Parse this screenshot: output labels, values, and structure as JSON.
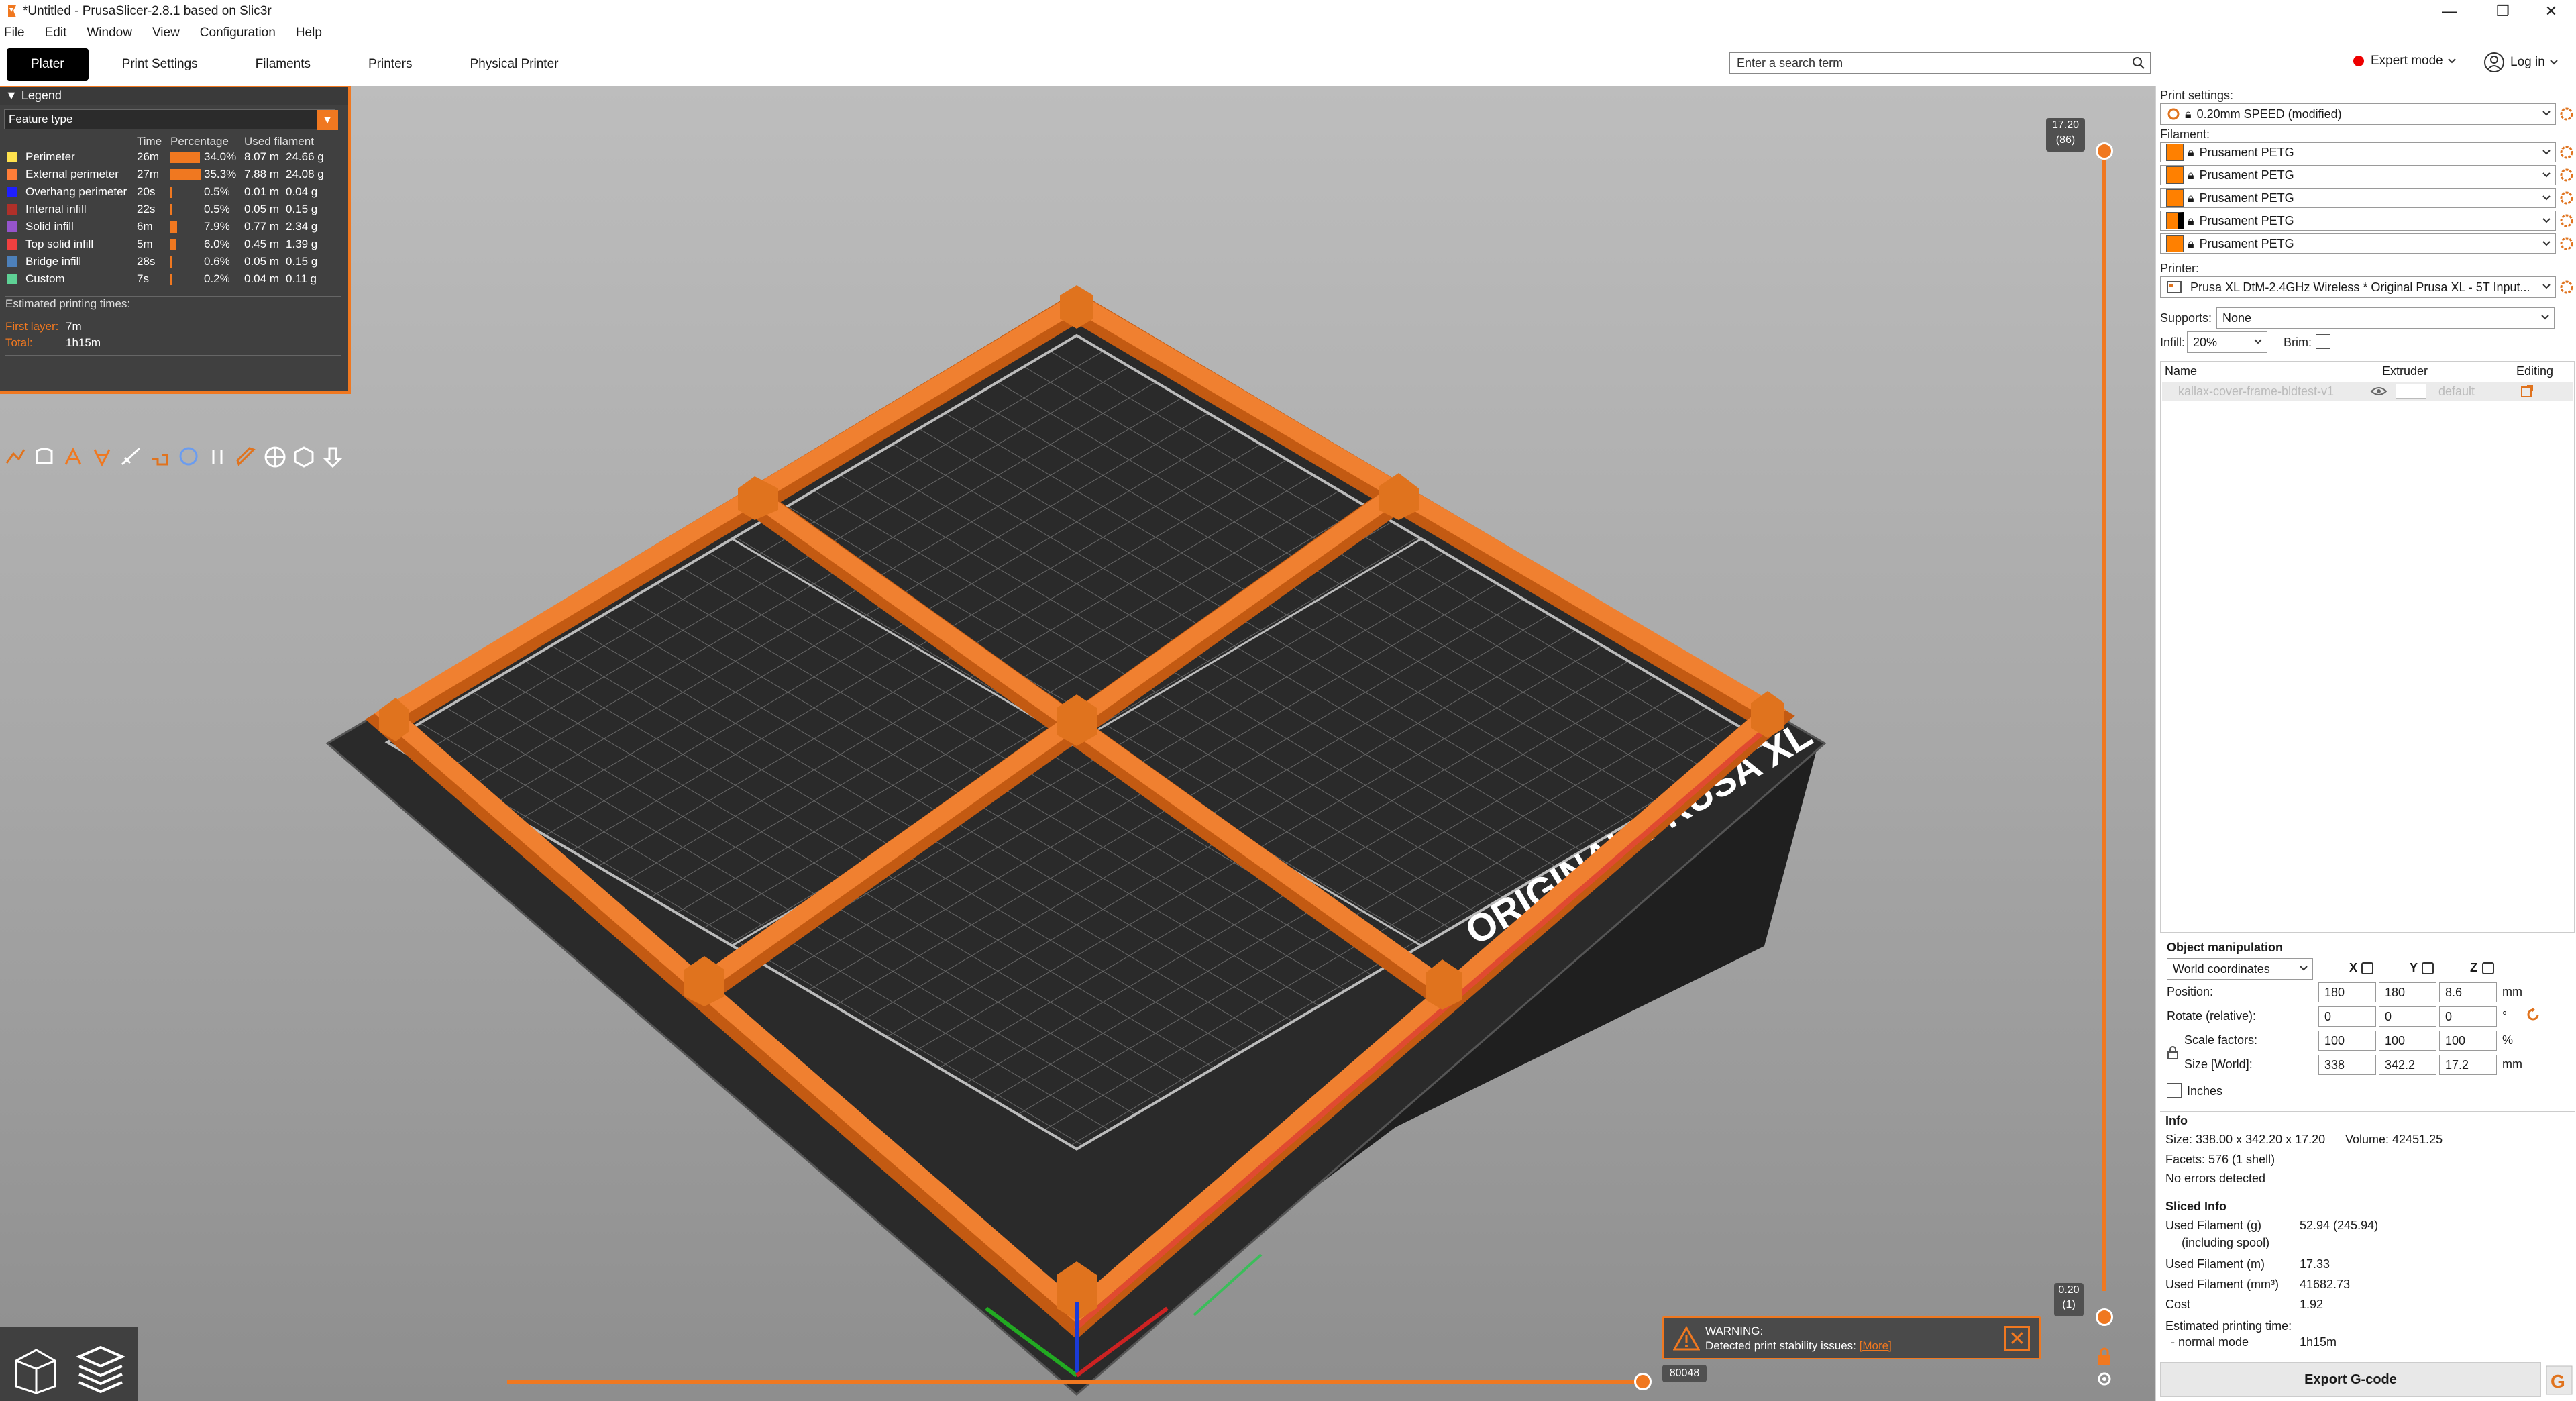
{
  "window": {
    "title": "*Untitled - PrusaSlicer-2.8.1 based on Slic3r",
    "minimize": "—",
    "maximize": "❐",
    "close": "✕"
  },
  "menu": [
    "File",
    "Edit",
    "Window",
    "View",
    "Configuration",
    "Help"
  ],
  "tabs": [
    "Plater",
    "Print Settings",
    "Filaments",
    "Printers",
    "Physical Printer"
  ],
  "search": {
    "placeholder": "Enter a search term"
  },
  "mode": {
    "label": "Expert mode",
    "color": "#e00000"
  },
  "login": {
    "label": "Log in"
  },
  "legend": {
    "title": "Legend",
    "view_type": "Feature type",
    "columns": [
      "Time",
      "Percentage",
      "Used filament"
    ],
    "rows": [
      {
        "name": "Perimeter",
        "color": "#ffe24d",
        "time": "26m",
        "pct": "34.0%",
        "pct_value": 34.0,
        "length": "8.07 m",
        "weight": "24.66 g"
      },
      {
        "name": "External perimeter",
        "color": "#ff7d38",
        "time": "27m",
        "pct": "35.3%",
        "pct_value": 35.3,
        "length": "7.88 m",
        "weight": "24.08 g"
      },
      {
        "name": "Overhang perimeter",
        "color": "#1f1fff",
        "time": "20s",
        "pct": "0.5%",
        "pct_value": 0.5,
        "length": "0.01 m",
        "weight": "0.04 g"
      },
      {
        "name": "Internal infill",
        "color": "#b03029",
        "time": "22s",
        "pct": "0.5%",
        "pct_value": 0.5,
        "length": "0.05 m",
        "weight": "0.15 g"
      },
      {
        "name": "Solid infill",
        "color": "#9654cc",
        "time": "6m",
        "pct": "7.9%",
        "pct_value": 7.9,
        "length": "0.77 m",
        "weight": "2.34 g"
      },
      {
        "name": "Top solid infill",
        "color": "#f04040",
        "time": "5m",
        "pct": "6.0%",
        "pct_value": 6.0,
        "length": "0.45 m",
        "weight": "1.39 g"
      },
      {
        "name": "Bridge infill",
        "color": "#4d80ba",
        "time": "28s",
        "pct": "0.6%",
        "pct_value": 0.6,
        "length": "0.05 m",
        "weight": "0.15 g"
      },
      {
        "name": "Custom",
        "color": "#5ed195",
        "time": "7s",
        "pct": "0.2%",
        "pct_value": 0.2,
        "length": "0.04 m",
        "weight": "0.11 g"
      }
    ],
    "est_title": "Estimated printing times:",
    "first_layer_label": "First layer:",
    "first_layer_value": "7m",
    "total_label": "Total:",
    "total_value": "1h15m",
    "tools": [
      "travel-icon",
      "wipe-icon",
      "retractions-icon",
      "deretractions-icon",
      "seams-icon",
      "tool-changes-icon",
      "color-changes-icon",
      "pause-icon",
      "custom-gcode-icon",
      "center-of-gravity-icon",
      "shells-icon",
      "tool-marker-icon"
    ]
  },
  "right": {
    "print_settings_label": "Print settings:",
    "print_settings_value": "0.20mm SPEED (modified)",
    "filament_label": "Filament:",
    "filaments": [
      {
        "name": "Prusament PETG",
        "color": "#ff8000"
      },
      {
        "name": "Prusament PETG",
        "color": "#ff8000"
      },
      {
        "name": "Prusament PETG",
        "color": "#ff8000"
      },
      {
        "name": "Prusament PETG",
        "color": "#ff8000"
      },
      {
        "name": "Prusament PETG",
        "color": "#ff8000"
      }
    ],
    "printer_label": "Printer:",
    "printer_value": "Prusa XL DtM-2.4GHz Wireless * Original Prusa XL - 5T Input...",
    "supports_label": "Supports:",
    "supports_value": "None",
    "infill_label": "Infill:",
    "infill_value": "20%",
    "brim_label": "Brim:",
    "list_headers": {
      "name": "Name",
      "extruder": "Extruder",
      "editing": "Editing"
    },
    "object_name": "kallax-cover-frame-bldtest-v1",
    "object_extruder": "default",
    "manip_title": "Object manipulation",
    "coord_system": "World coordinates",
    "axes": [
      "X",
      "Y",
      "Z"
    ],
    "position_label": "Position:",
    "position": [
      "180",
      "180",
      "8.6"
    ],
    "rotate_label": "Rotate (relative):",
    "rotate": [
      "0",
      "0",
      "0"
    ],
    "scale_label": "Scale factors:",
    "scale": [
      "100",
      "100",
      "100"
    ],
    "size_label": "Size [World]:",
    "size": [
      "338",
      "342.2",
      "17.2"
    ],
    "unit_mm": "mm",
    "unit_deg": "°",
    "unit_pct": "%",
    "inches_label": "Inches",
    "info_title": "Info",
    "info_size": "Size:   338.00 x 342.20 x 17.20",
    "info_volume": "Volume:   42451.25",
    "info_facets": "Facets:   576 (1 shell)",
    "info_errors": "No errors detected",
    "sliced_title": "Sliced Info",
    "sliced": [
      {
        "label": "Used Filament (g)",
        "value": "52.94 (245.94)"
      },
      {
        "label": "(including spool)",
        "value": ""
      },
      {
        "label": "Used Filament (m)",
        "value": "17.33"
      },
      {
        "label": "Used Filament (mm³)",
        "value": "41682.73"
      },
      {
        "label": "Cost",
        "value": "1.92"
      },
      {
        "label": "Estimated printing time:",
        "value": ""
      },
      {
        "label": "- normal mode",
        "value": "1h15m"
      }
    ],
    "export_label": "Export G-code"
  },
  "viewport": {
    "bed_text": "ORIGINAL PRUSA XL",
    "slider_top": "17.20",
    "slider_top_layer": "(86)",
    "slider_bottom": "0.20",
    "slider_bottom_layer": "(1)",
    "horizontal_value": "80048",
    "warning_title": "WARNING:",
    "warning_text": "Detected print stability issues:",
    "warning_link": "[More]"
  },
  "colors": {
    "accent": "#f07820",
    "print": "#e0731e",
    "bed": "#2d2d2d"
  }
}
